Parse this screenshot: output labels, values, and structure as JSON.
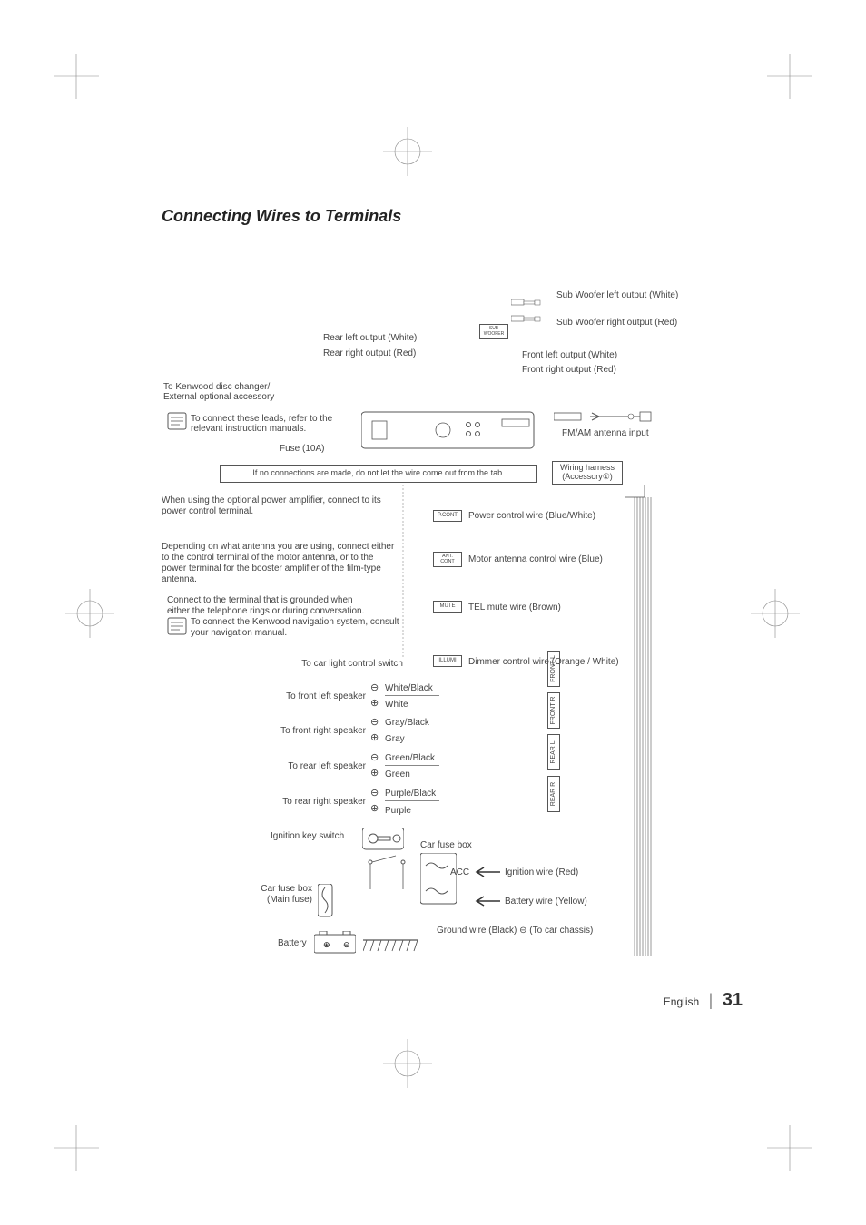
{
  "title": "Connecting Wires to Terminals",
  "labels": {
    "swL": "Sub Woofer left output  (White)",
    "swR": "Sub Woofer right output  (Red)",
    "rearL": "Rear left output (White)",
    "rearR": "Rear right output (Red)",
    "frontL": "Front left output (White)",
    "frontR": "Front right output (Red)",
    "disc1": "To Kenwood disc changer/",
    "disc2": "External optional accessory",
    "note1a": "To connect these leads, refer to the",
    "note1b": "relevant instruction manuals.",
    "fuse": "Fuse (10A)",
    "fm": "FM/AM antenna input",
    "noconn": "If no connections are made, do not let the wire come out from the tab.",
    "harness1": "Wiring harness",
    "harness2": "(Accessory①)",
    "amp1": "When using the optional power amplifier, connect to its",
    "amp2": "power control terminal.",
    "pcont": "Power control wire (Blue/White)",
    "antnote1": "Depending on what antenna you are using, connect either",
    "antnote2": "to the control terminal of the motor antenna, or to the",
    "antnote3": "power terminal for the booster amplifier of the film-type",
    "antnote4": "antenna.",
    "motorant": "Motor antenna control wire (Blue)",
    "tel1": "Connect to the terminal that is grounded when",
    "tel2": "either the telephone rings or during conversation.",
    "nav1": "To connect the Kenwood navigation system, consult",
    "nav2": "your navigation manual.",
    "telmute": "TEL mute wire (Brown)",
    "carlight": "To car light control switch",
    "dimmer": "Dimmer control wire (Orange / White)",
    "fl": "To front left speaker",
    "fr": "To front right speaker",
    "rl": "To rear left speaker",
    "rr": "To rear right speaker",
    "wb": "White/Black",
    "w": "White",
    "gb": "Gray/Black",
    "g": "Gray",
    "grnb": "Green/Black",
    "grn": "Green",
    "pb": "Purple/Black",
    "p": "Purple",
    "ignkey": "Ignition key switch",
    "fusebox": "Car fuse box",
    "mainfuse1": "Car fuse box",
    "mainfuse2": "(Main fuse)",
    "acc": "ACC",
    "ignwire": "Ignition wire (Red)",
    "batwire": "Battery wire (Yellow)",
    "gnd": "Ground wire (Black) ⊖ (To car chassis)",
    "battery": "Battery"
  },
  "tags": {
    "sub": "SUB WOOFER",
    "pcont": "P.CONT",
    "antcont": "ANT. CONT",
    "mute": "MUTE",
    "illumi": "ILLUMI",
    "frontl": "FRONT L",
    "frontr": "FRONT R",
    "rearl": "REAR L",
    "rearr": "REAR R"
  },
  "footer": {
    "lang": "English",
    "page": "31"
  }
}
